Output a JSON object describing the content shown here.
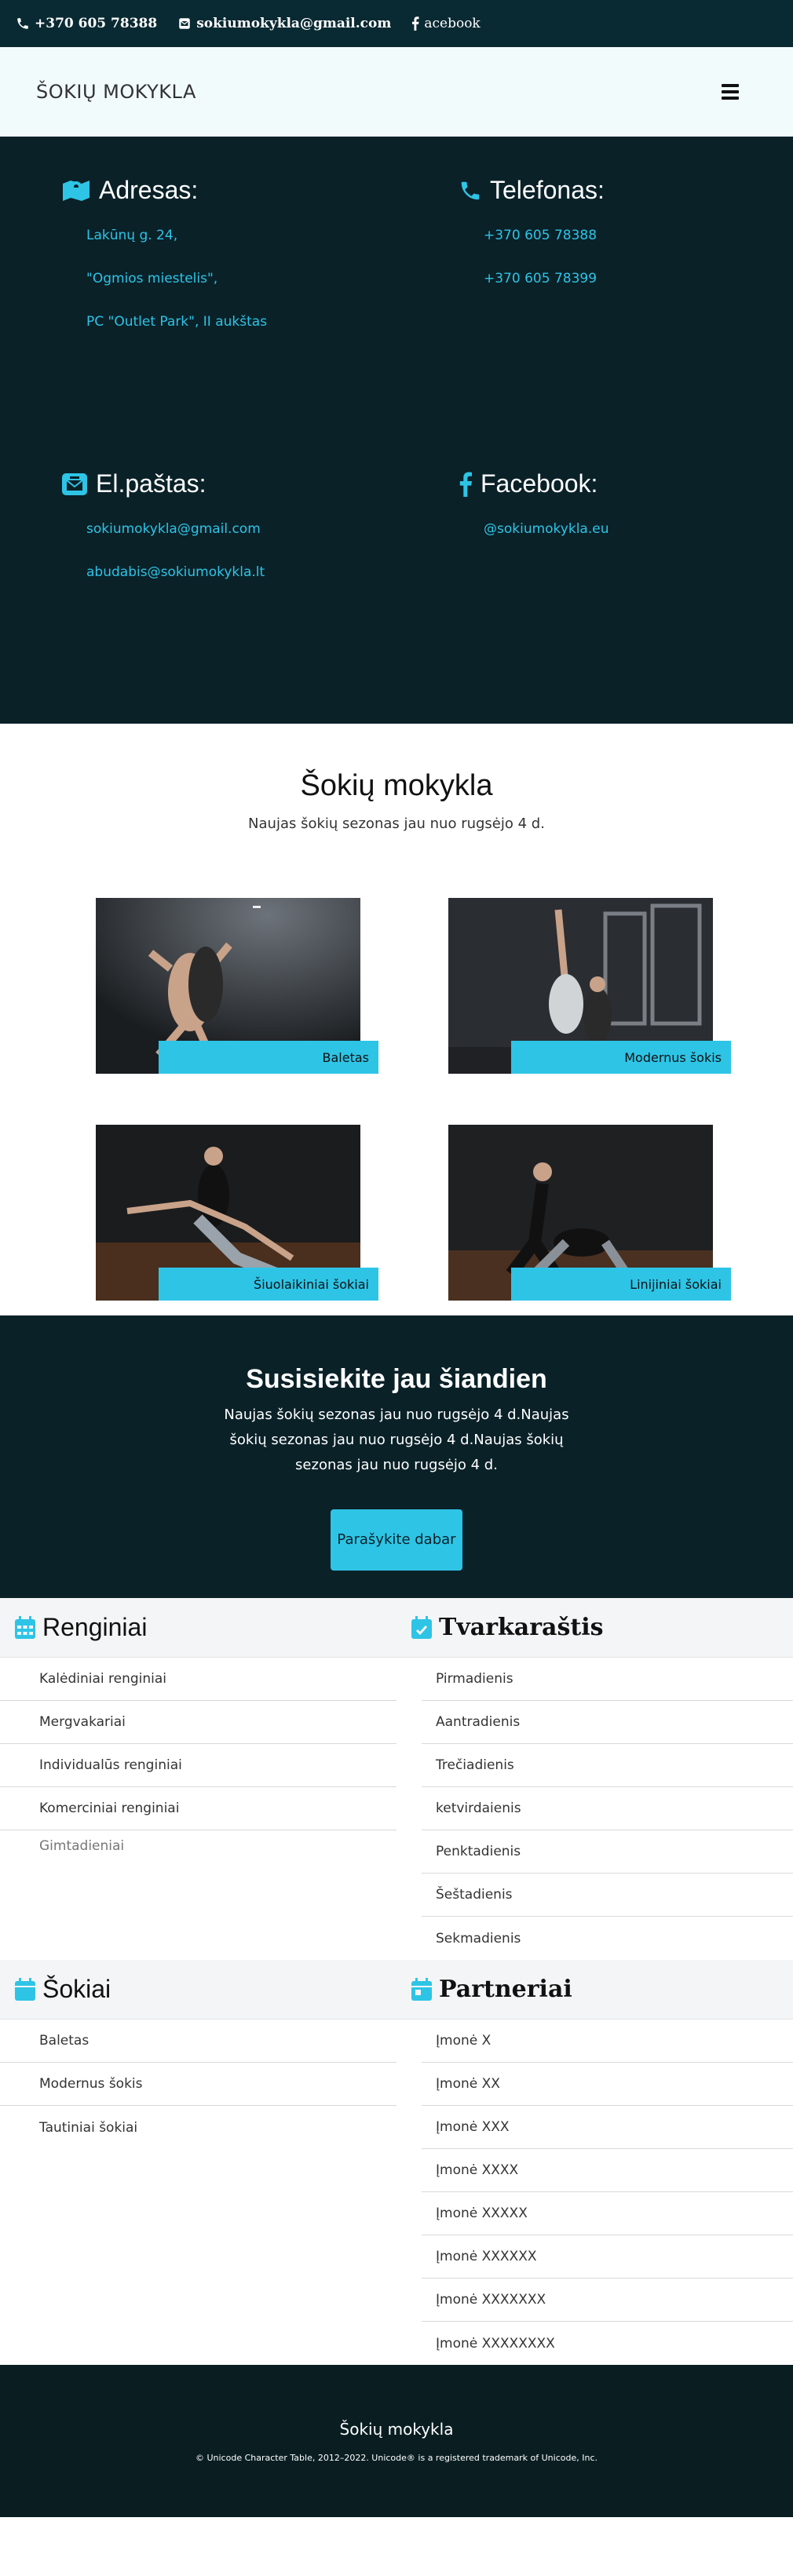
{
  "topbar": {
    "phone": "+370 605 78388",
    "email": "sokiumokykla@gmail.com",
    "facebook": "acebook"
  },
  "navbar": {
    "brand": "ŠOKIŲ MOKYKLA"
  },
  "contact": {
    "address": {
      "title": "Adresas:",
      "lines": [
        "Lakūnų g. 24,",
        "\"Ogmios miestelis\",",
        "PC \"Outlet Park\", II aukštas"
      ]
    },
    "phone": {
      "title": "Telefonas:",
      "lines": [
        "+370 605 78388",
        "+370 605 78399"
      ]
    },
    "email": {
      "title": "El.paštas:",
      "lines": [
        "sokiumokykla@gmail.com",
        "abudabis@sokiumokykla.lt"
      ]
    },
    "facebook": {
      "title": "Facebook:",
      "lines": [
        "@sokiumokykla.eu"
      ]
    }
  },
  "intro": {
    "title": "Šokių mokykla",
    "subtitle": "Naujas šokių sezonas jau nuo rugsėjo 4 d."
  },
  "gallery": [
    "Baletas",
    "Modernus šokis",
    "Šiuolaikiniai šokiai",
    "Linijiniai šokiai"
  ],
  "cta": {
    "title": "Susisiekite jau šiandien",
    "text": "Naujas šokių sezonas jau nuo rugsėjo 4 d.Naujas šokių sezonas jau nuo rugsėjo 4 d.Naujas šokių sezonas jau nuo rugsėjo 4 d.",
    "button": "Parašykite dabar"
  },
  "lists": {
    "renginiai": {
      "title": "Renginiai",
      "items": [
        "Kalėdiniai renginiai",
        "Mergvakariai",
        "Individualūs renginiai",
        "Komerciniai renginiai",
        "Gimtadieniai"
      ]
    },
    "tvarkarastis": {
      "title": "Tvarkaraštis",
      "items": [
        "Pirmadienis",
        "Aantradienis",
        "Trečiadienis",
        "ketvirdaienis",
        "Penktadienis",
        "Šeštadienis",
        "Sekmadienis"
      ]
    },
    "sokiai": {
      "title": "Šokiai",
      "items": [
        "Baletas",
        "Modernus šokis",
        "Tautiniai šokiai"
      ]
    },
    "partneriai": {
      "title": "Partneriai",
      "items": [
        "Įmonė X",
        "Įmonė XX",
        "Įmonė XXX",
        "Įmonė XXXX",
        "Įmonė XXXXX",
        "Įmonė XXXXXX",
        "Įmonė XXXXXXX",
        "Įmonė XXXXXXXX"
      ]
    }
  },
  "footer": {
    "title": "Šokių mokykla",
    "copyright": "© Unicode Character Table, 2012–2022. Unicode® is a registered trademark of Unicode, Inc."
  },
  "colors": {
    "dark": "#0a2128",
    "accent": "#2ec4e6",
    "light": "#f1fbfc"
  }
}
